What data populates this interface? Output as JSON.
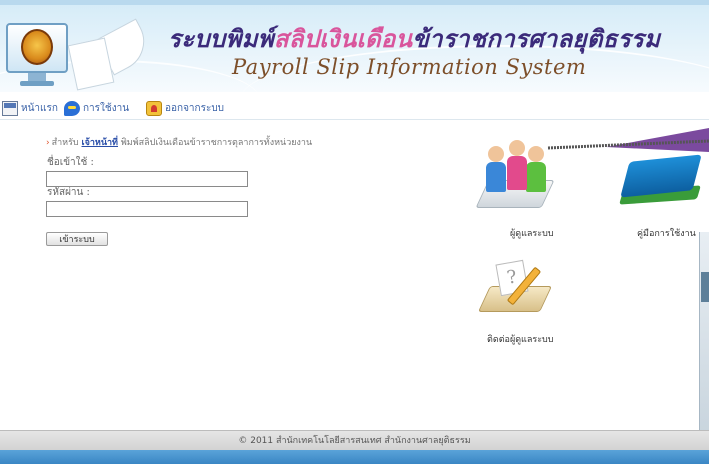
{
  "header": {
    "title_th_main": "ระบบพิมพ์",
    "title_th_accent": "สลิปเงินเดือน",
    "title_th_rest": "ข้าราชการศาลยุติธรรม",
    "title_en": "Payroll Slip Information System"
  },
  "menu": {
    "items": [
      {
        "label": "หน้าแรก",
        "icon": "home-icon"
      },
      {
        "label": "การใช้งาน",
        "icon": "chat-icon"
      },
      {
        "label": "ออกจากระบบ",
        "icon": "exit-icon"
      }
    ]
  },
  "login": {
    "breadcrumb_prefix": "สำหรับ",
    "breadcrumb_link": "เจ้าหน้าที่",
    "breadcrumb_suffix": "พิมพ์สลิปเงินเดือนข้าราชการตุลาการทั้งหน่วยงาน",
    "username_label": "ชื่อเข้าใช้ :",
    "username_value": "",
    "password_label": "รหัสผ่าน :",
    "password_value": "",
    "submit_label": "เข้าระบบ"
  },
  "tiles": {
    "admin_label": "ผู้ดูแลระบบ",
    "manual_label": "คู่มือการใช้งาน",
    "contact_label": "ติดต่อผู้ดูแลระบบ"
  },
  "footer": {
    "text": "© 2011 สำนักเทคโนโลยีสารสนเทศ สำนักงานศาลยุติธรรม"
  },
  "colors": {
    "title_purple": "#3b2a7a",
    "title_pink": "#d9559c",
    "callout_purple": "#7b4a9e",
    "link_blue": "#2a4ea8"
  }
}
